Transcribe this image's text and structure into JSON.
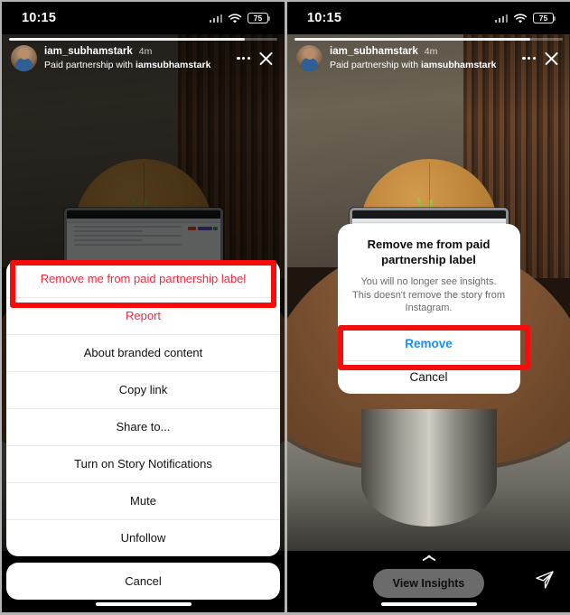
{
  "status_bar": {
    "time": "10:15",
    "battery_percent": "75",
    "wifi_icon": "wifi-icon",
    "signal_icon": "cellular-signal-icon",
    "battery_icon": "battery-icon"
  },
  "story": {
    "username": "iam_subhamstark",
    "timestamp": "4m",
    "paid_partnership_prefix": "Paid partnership with ",
    "paid_partnership_partner": "iamsubhamstark",
    "more_icon": "more-options-icon",
    "close_icon": "close-icon",
    "avatar": "avatar",
    "progress_percent": 88
  },
  "left_panel": {
    "action_sheet": {
      "items": [
        {
          "label": "Remove me from paid partnership label",
          "style": "destructive",
          "highlighted": true
        },
        {
          "label": "Report",
          "style": "destructive",
          "highlighted": false
        },
        {
          "label": "About branded content",
          "style": "default",
          "highlighted": false
        },
        {
          "label": "Copy link",
          "style": "default",
          "highlighted": false
        },
        {
          "label": "Share to...",
          "style": "default",
          "highlighted": false
        },
        {
          "label": "Turn on Story Notifications",
          "style": "default",
          "highlighted": false
        },
        {
          "label": "Mute",
          "style": "default",
          "highlighted": false
        },
        {
          "label": "Unfollow",
          "style": "default",
          "highlighted": false
        }
      ],
      "cancel_label": "Cancel"
    }
  },
  "right_panel": {
    "alert": {
      "title": "Remove me from paid partnership label",
      "message": "You will no longer see insights. This doesn't remove the story from Instagram.",
      "confirm_label": "Remove",
      "cancel_label": "Cancel"
    },
    "bottom_bar": {
      "view_insights_label": "View Insights",
      "chevron_up_icon": "chevron-up-icon",
      "send_icon": "send-message-icon"
    }
  },
  "colors": {
    "annotation_red": "#f60c0c",
    "destructive_red": "#ed2a3f",
    "action_blue": "#1b8df0"
  }
}
